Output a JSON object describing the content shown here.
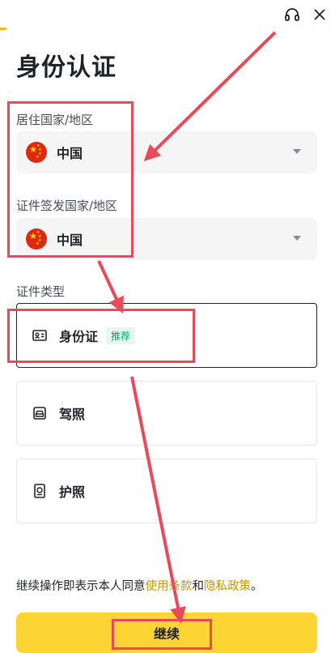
{
  "header": {
    "support_icon": "headset-icon",
    "close_icon": "close-icon"
  },
  "progress": {
    "value_percent": 2,
    "color": "#f0b90b"
  },
  "page_title": "身份认证",
  "residence": {
    "label": "居住国家/地区",
    "value": "中国",
    "flag_icon": "china-flag-icon"
  },
  "issuing": {
    "label": "证件签发国家/地区",
    "value": "中国",
    "flag_icon": "china-flag-icon"
  },
  "doc_type": {
    "label": "证件类型",
    "options": [
      {
        "label": "身份证",
        "badge": "推荐",
        "icon": "id-card-icon",
        "selected": true
      },
      {
        "label": "驾照",
        "icon": "car-icon",
        "selected": false
      },
      {
        "label": "护照",
        "icon": "passport-icon",
        "selected": false
      }
    ]
  },
  "legal": {
    "prefix": "继续操作即表示本人同意",
    "terms": "使用条款",
    "and": "和",
    "privacy": "隐私政策",
    "suffix": "。"
  },
  "continue_label": "继续",
  "colors": {
    "accent": "#fcd535",
    "link": "#c99400",
    "annotation": "#e84a5a",
    "badge_text": "#03a66d"
  }
}
